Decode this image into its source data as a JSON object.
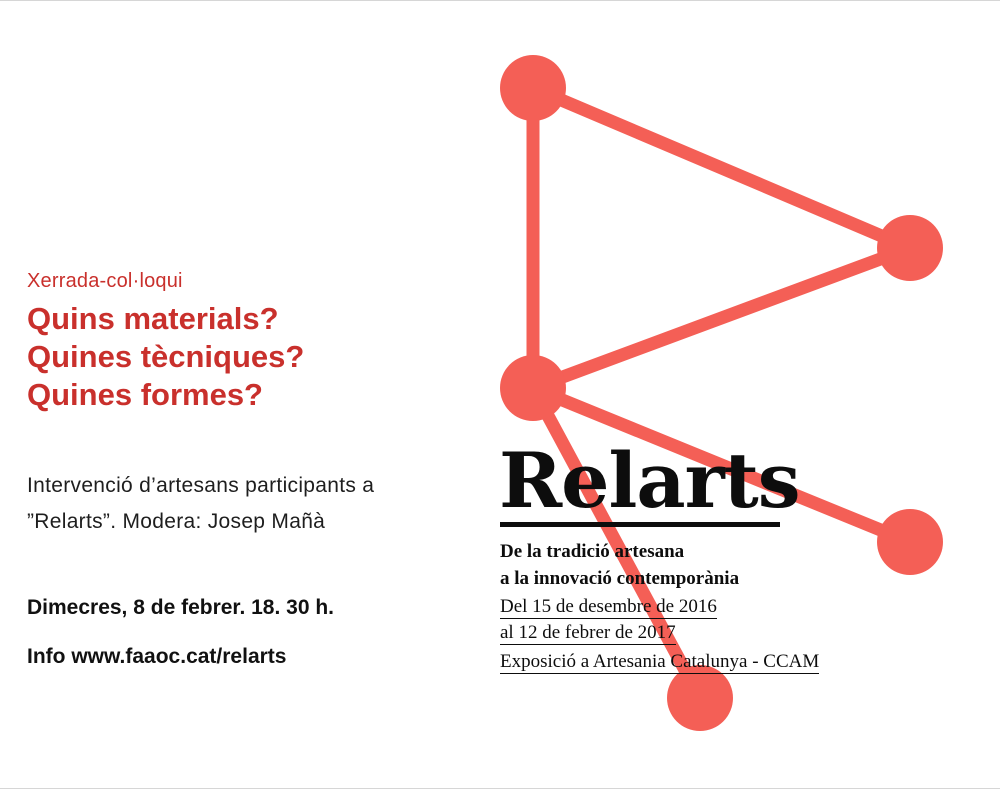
{
  "poster": {
    "kicker": "Xerrada-col·loqui",
    "questions": [
      "Quins materials?",
      "Quines tècniques?",
      "Quines formes?"
    ],
    "intro": "Intervenció d’artesans participants a ”Relarts”. Modera: Josep Mañà",
    "date": "Dimecres, 8 de febrer. 18. 30 h.",
    "info": "Info www.faaoc.cat/relarts"
  },
  "exhibition": {
    "brand": "Relarts",
    "subtitle_line1": "De la tradició artesana",
    "subtitle_line2": "a la innovació contemporània",
    "dates_line1": "Del 15 de desembre de 2016",
    "dates_line2": "al 12 de febrer de 2017",
    "venue": "Exposició a Artesania Catalunya - CCAM"
  },
  "colors": {
    "accent_red": "#c9302c",
    "graphic_coral": "#f45f56",
    "text_dark": "#0d0d0d"
  }
}
